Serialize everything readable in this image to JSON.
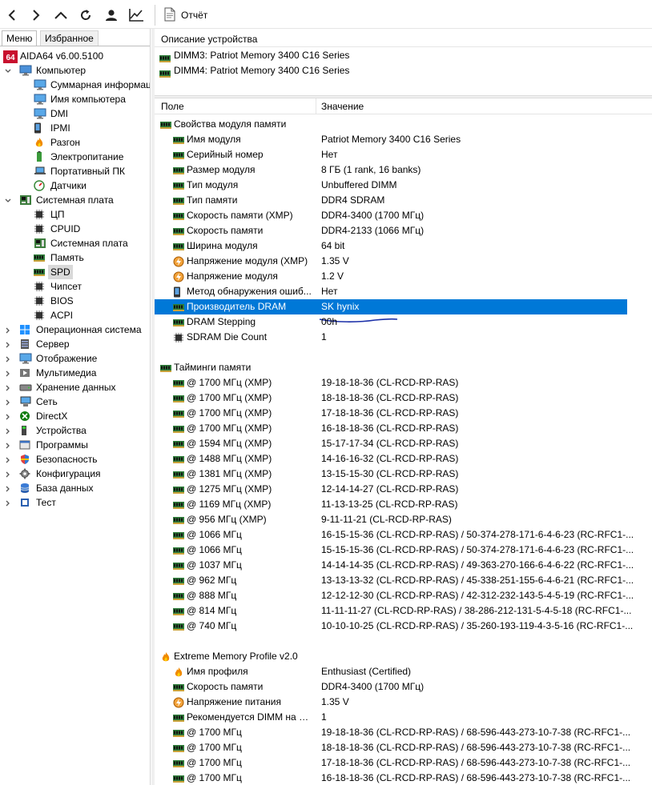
{
  "toolbar": {
    "report_label": "Отчёт",
    "icons": [
      "back-icon",
      "forward-icon",
      "up-icon",
      "refresh-icon",
      "user-icon",
      "chart-icon"
    ]
  },
  "left": {
    "tabs": [
      {
        "label": "Меню",
        "active": true
      },
      {
        "label": "Избранное",
        "active": false
      }
    ],
    "tree": [
      {
        "depth": 0,
        "chev": "",
        "icon": "aida64",
        "label": "AIDA64 v6.00.5100"
      },
      {
        "depth": 0,
        "chev": "open",
        "icon": "computer",
        "label": "Компьютер"
      },
      {
        "depth": 1,
        "chev": "",
        "icon": "monitor",
        "label": "Суммарная информац"
      },
      {
        "depth": 1,
        "chev": "",
        "icon": "monitor",
        "label": "Имя компьютера"
      },
      {
        "depth": 1,
        "chev": "",
        "icon": "monitor",
        "label": "DMI"
      },
      {
        "depth": 1,
        "chev": "",
        "icon": "phone",
        "label": "IPMI"
      },
      {
        "depth": 1,
        "chev": "",
        "icon": "flame",
        "label": "Разгон"
      },
      {
        "depth": 1,
        "chev": "",
        "icon": "power",
        "label": "Электропитание"
      },
      {
        "depth": 1,
        "chev": "",
        "icon": "laptop",
        "label": "Портативный ПК"
      },
      {
        "depth": 1,
        "chev": "",
        "icon": "gauge",
        "label": "Датчики"
      },
      {
        "depth": 0,
        "chev": "open",
        "icon": "board",
        "label": "Системная плата"
      },
      {
        "depth": 1,
        "chev": "",
        "icon": "chip",
        "label": "ЦП"
      },
      {
        "depth": 1,
        "chev": "",
        "icon": "chip",
        "label": "CPUID"
      },
      {
        "depth": 1,
        "chev": "",
        "icon": "board",
        "label": "Системная плата"
      },
      {
        "depth": 1,
        "chev": "",
        "icon": "ram",
        "label": "Память"
      },
      {
        "depth": 1,
        "chev": "",
        "icon": "ram",
        "label": "SPD",
        "selected": true
      },
      {
        "depth": 1,
        "chev": "",
        "icon": "chip",
        "label": "Чипсет"
      },
      {
        "depth": 1,
        "chev": "",
        "icon": "chip",
        "label": "BIOS"
      },
      {
        "depth": 1,
        "chev": "",
        "icon": "chip",
        "label": "ACPI"
      },
      {
        "depth": 0,
        "chev": "closed",
        "icon": "windows",
        "label": "Операционная система"
      },
      {
        "depth": 0,
        "chev": "closed",
        "icon": "server",
        "label": "Сервер"
      },
      {
        "depth": 0,
        "chev": "closed",
        "icon": "monitor",
        "label": "Отображение"
      },
      {
        "depth": 0,
        "chev": "closed",
        "icon": "media",
        "label": "Мультимедиа"
      },
      {
        "depth": 0,
        "chev": "closed",
        "icon": "disk",
        "label": "Хранение данных"
      },
      {
        "depth": 0,
        "chev": "closed",
        "icon": "network",
        "label": "Сеть"
      },
      {
        "depth": 0,
        "chev": "closed",
        "icon": "xbox",
        "label": "DirectX"
      },
      {
        "depth": 0,
        "chev": "closed",
        "icon": "device",
        "label": "Устройства"
      },
      {
        "depth": 0,
        "chev": "closed",
        "icon": "apps",
        "label": "Программы"
      },
      {
        "depth": 0,
        "chev": "closed",
        "icon": "shield",
        "label": "Безопасность"
      },
      {
        "depth": 0,
        "chev": "closed",
        "icon": "gear",
        "label": "Конфигурация"
      },
      {
        "depth": 0,
        "chev": "closed",
        "icon": "database",
        "label": "База данных"
      },
      {
        "depth": 0,
        "chev": "closed",
        "icon": "test",
        "label": "Тест"
      }
    ]
  },
  "right": {
    "device_header": "Описание устройства",
    "devices": [
      "DIMM3: Patriot Memory 3400 C16 Series",
      "DIMM4: Patriot Memory 3400 C16 Series"
    ],
    "col_field": "Поле",
    "col_value": "Значение",
    "rows": [
      {
        "kind": "sec",
        "icon": "ram",
        "field": "Свойства модуля памяти",
        "value": ""
      },
      {
        "kind": "item",
        "icon": "ram",
        "field": "Имя модуля",
        "value": "Patriot Memory 3400 C16 Series"
      },
      {
        "kind": "item",
        "icon": "ram",
        "field": "Серийный номер",
        "value": "Нет"
      },
      {
        "kind": "item",
        "icon": "ram",
        "field": "Размер модуля",
        "value": "8 ГБ (1 rank, 16 banks)"
      },
      {
        "kind": "item",
        "icon": "ram",
        "field": "Тип модуля",
        "value": "Unbuffered DIMM"
      },
      {
        "kind": "item",
        "icon": "ram",
        "field": "Тип памяти",
        "value": "DDR4 SDRAM"
      },
      {
        "kind": "item",
        "icon": "ram",
        "field": "Скорость памяти (XMP)",
        "value": "DDR4-3400 (1700 МГц)"
      },
      {
        "kind": "item",
        "icon": "ram",
        "field": "Скорость памяти",
        "value": "DDR4-2133 (1066 МГц)"
      },
      {
        "kind": "item",
        "icon": "ram",
        "field": "Ширина модуля",
        "value": "64 bit"
      },
      {
        "kind": "item",
        "icon": "volt",
        "field": "Напряжение модуля (XMP)",
        "value": "1.35 V"
      },
      {
        "kind": "item",
        "icon": "volt",
        "field": "Напряжение модуля",
        "value": "1.2 V"
      },
      {
        "kind": "item",
        "icon": "phone",
        "field": "Метод обнаружения ошиб...",
        "value": "Нет"
      },
      {
        "kind": "item",
        "icon": "ram",
        "field": "Производитель DRAM",
        "value": "SK hynix",
        "highlight": true
      },
      {
        "kind": "item",
        "icon": "ram",
        "field": "DRAM Stepping",
        "value": "00h"
      },
      {
        "kind": "item",
        "icon": "chip",
        "field": "SDRAM Die Count",
        "value": "1"
      },
      {
        "kind": "gap"
      },
      {
        "kind": "sec",
        "icon": "ram",
        "field": "Тайминги памяти",
        "value": ""
      },
      {
        "kind": "item",
        "icon": "ram",
        "field": "@ 1700 МГц (XMP)",
        "value": "19-18-18-36  (CL-RCD-RP-RAS)"
      },
      {
        "kind": "item",
        "icon": "ram",
        "field": "@ 1700 МГц (XMP)",
        "value": "18-18-18-36  (CL-RCD-RP-RAS)"
      },
      {
        "kind": "item",
        "icon": "ram",
        "field": "@ 1700 МГц (XMP)",
        "value": "17-18-18-36  (CL-RCD-RP-RAS)"
      },
      {
        "kind": "item",
        "icon": "ram",
        "field": "@ 1700 МГц (XMP)",
        "value": "16-18-18-36  (CL-RCD-RP-RAS)"
      },
      {
        "kind": "item",
        "icon": "ram",
        "field": "@ 1594 МГц (XMP)",
        "value": "15-17-17-34  (CL-RCD-RP-RAS)"
      },
      {
        "kind": "item",
        "icon": "ram",
        "field": "@ 1488 МГц (XMP)",
        "value": "14-16-16-32  (CL-RCD-RP-RAS)"
      },
      {
        "kind": "item",
        "icon": "ram",
        "field": "@ 1381 МГц (XMP)",
        "value": "13-15-15-30  (CL-RCD-RP-RAS)"
      },
      {
        "kind": "item",
        "icon": "ram",
        "field": "@ 1275 МГц (XMP)",
        "value": "12-14-14-27  (CL-RCD-RP-RAS)"
      },
      {
        "kind": "item",
        "icon": "ram",
        "field": "@ 1169 МГц (XMP)",
        "value": "11-13-13-25  (CL-RCD-RP-RAS)"
      },
      {
        "kind": "item",
        "icon": "ram",
        "field": "@ 956 МГц (XMP)",
        "value": "9-11-11-21  (CL-RCD-RP-RAS)"
      },
      {
        "kind": "item",
        "icon": "ram",
        "field": "@ 1066 МГц",
        "value": "16-15-15-36  (CL-RCD-RP-RAS) / 50-374-278-171-6-4-6-23  (RC-RFC1-..."
      },
      {
        "kind": "item",
        "icon": "ram",
        "field": "@ 1066 МГц",
        "value": "15-15-15-36  (CL-RCD-RP-RAS) / 50-374-278-171-6-4-6-23  (RC-RFC1-..."
      },
      {
        "kind": "item",
        "icon": "ram",
        "field": "@ 1037 МГц",
        "value": "14-14-14-35  (CL-RCD-RP-RAS) / 49-363-270-166-6-4-6-22  (RC-RFC1-..."
      },
      {
        "kind": "item",
        "icon": "ram",
        "field": "@ 962 МГц",
        "value": "13-13-13-32  (CL-RCD-RP-RAS) / 45-338-251-155-6-4-6-21  (RC-RFC1-..."
      },
      {
        "kind": "item",
        "icon": "ram",
        "field": "@ 888 МГц",
        "value": "12-12-12-30  (CL-RCD-RP-RAS) / 42-312-232-143-5-4-5-19  (RC-RFC1-..."
      },
      {
        "kind": "item",
        "icon": "ram",
        "field": "@ 814 МГц",
        "value": "11-11-11-27  (CL-RCD-RP-RAS) / 38-286-212-131-5-4-5-18  (RC-RFC1-..."
      },
      {
        "kind": "item",
        "icon": "ram",
        "field": "@ 740 МГц",
        "value": "10-10-10-25  (CL-RCD-RP-RAS) / 35-260-193-119-4-3-5-16  (RC-RFC1-..."
      },
      {
        "kind": "gap"
      },
      {
        "kind": "sec",
        "icon": "flame",
        "field": "Extreme Memory Profile v2.0",
        "value": ""
      },
      {
        "kind": "item",
        "icon": "flame",
        "field": "Имя профиля",
        "value": "Enthusiast (Certified)"
      },
      {
        "kind": "item",
        "icon": "ram",
        "field": "Скорость памяти",
        "value": "DDR4-3400 (1700 МГц)"
      },
      {
        "kind": "item",
        "icon": "volt",
        "field": "Напряжение питания",
        "value": "1.35 V"
      },
      {
        "kind": "item",
        "icon": "ram",
        "field": "Рекомендуется DIMM на ка...",
        "value": "1"
      },
      {
        "kind": "item",
        "icon": "ram",
        "field": "@ 1700 МГц",
        "value": "19-18-18-36  (CL-RCD-RP-RAS) / 68-596-443-273-10-7-38  (RC-RFC1-..."
      },
      {
        "kind": "item",
        "icon": "ram",
        "field": "@ 1700 МГц",
        "value": "18-18-18-36  (CL-RCD-RP-RAS) / 68-596-443-273-10-7-38  (RC-RFC1-..."
      },
      {
        "kind": "item",
        "icon": "ram",
        "field": "@ 1700 МГц",
        "value": "17-18-18-36  (CL-RCD-RP-RAS) / 68-596-443-273-10-7-38  (RC-RFC1-..."
      },
      {
        "kind": "item",
        "icon": "ram",
        "field": "@ 1700 МГц",
        "value": "16-18-18-36  (CL-RCD-RP-RAS) / 68-596-443-273-10-7-38  (RC-RFC1-..."
      }
    ]
  },
  "colors": {
    "selection": "#0078d7",
    "tree_selection": "#d9d9d9",
    "underline_mark": "#1a2fa8"
  }
}
